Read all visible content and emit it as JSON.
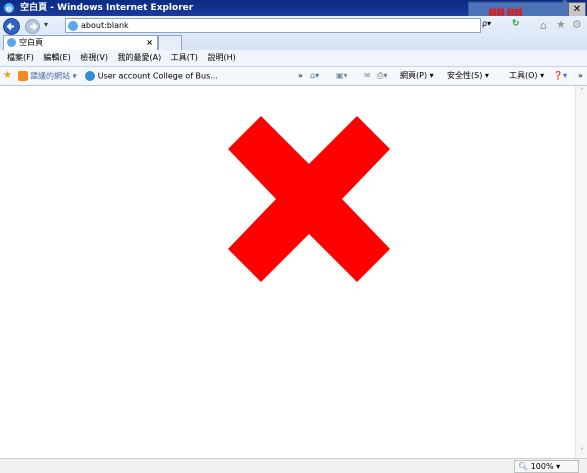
{
  "window": {
    "title": "空白頁 - Windows Internet Explorer"
  },
  "callout": {
    "text": "關閉"
  },
  "address": {
    "url": "about:blank",
    "search_arrow": "ρ▾"
  },
  "tab": {
    "label": "空白頁",
    "close": "×"
  },
  "menu": {
    "items": [
      "檔案(F)",
      "編輯(E)",
      "檢視(V)",
      "我的最愛(A)",
      "工具(T)",
      "說明(H)"
    ]
  },
  "favorites": {
    "suggested": "建議的網站 ▾",
    "link": "User account  College of Bus...",
    "toolbar_right": [
      "網頁(P) ▾",
      "安全性(S) ▾",
      "工具(O) ▾"
    ]
  },
  "status": {
    "zoom": "100%"
  },
  "colors": {
    "close_mark": "#ff0000",
    "title_bar": "#0b2a83"
  }
}
